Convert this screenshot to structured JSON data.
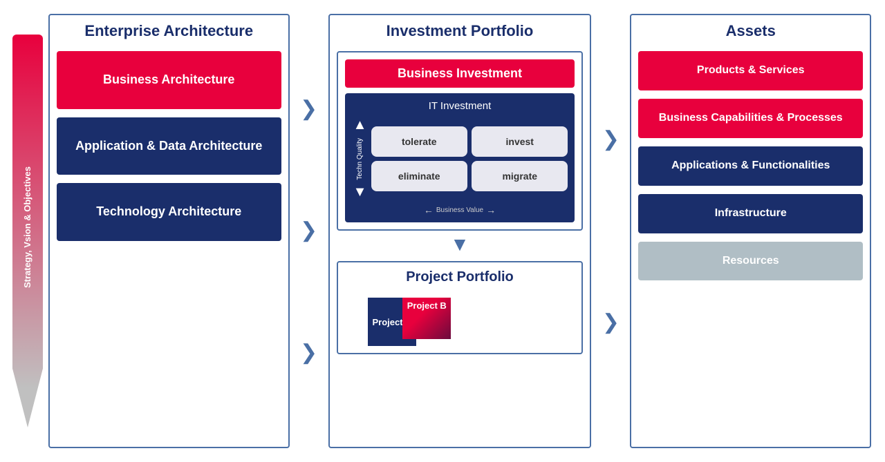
{
  "vertical_label": "Strategy, Vsion & Objectives",
  "columns": {
    "enterprise_architecture": {
      "title": "Enterprise Architecture",
      "boxes": [
        {
          "label": "Business Architecture",
          "type": "red"
        },
        {
          "label": "Application & Data Architecture",
          "type": "navy"
        },
        {
          "label": "Technology Architecture",
          "type": "navy"
        }
      ]
    },
    "investment_portfolio": {
      "title": "Investment Portfolio",
      "business_investment": "Business Investment",
      "it_investment": {
        "title": "IT Investment",
        "quadrants": [
          "tolerate",
          "invest",
          "eliminate",
          "migrate"
        ],
        "tech_quality_label": "Techn Quality",
        "business_value_label": "Business Value"
      },
      "project_portfolio": {
        "title": "Project Portfolio",
        "projects": [
          {
            "label": "Project A",
            "type": "navy"
          },
          {
            "label": "Project B",
            "type": "red"
          }
        ]
      }
    },
    "assets": {
      "title": "Assets",
      "boxes": [
        {
          "label": "Products & Services",
          "type": "red"
        },
        {
          "label": "Business Capabilities & Processes",
          "type": "red"
        },
        {
          "label": "Applications & Functionalities",
          "type": "navy"
        },
        {
          "label": "Infrastructure",
          "type": "navy"
        },
        {
          "label": "Resources",
          "type": "gray"
        }
      ]
    }
  },
  "arrows": {
    "right_arrow": "❯",
    "down_arrow": "▼",
    "up_arrow": "▲"
  }
}
